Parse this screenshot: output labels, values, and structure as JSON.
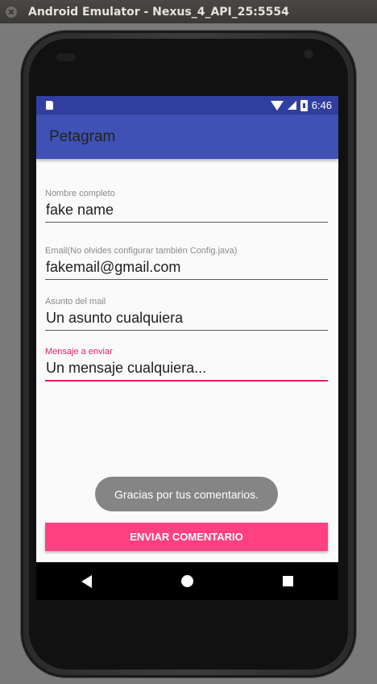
{
  "window": {
    "title": "Android Emulator - Nexus_4_API_25:5554"
  },
  "status_bar": {
    "time": "6:46",
    "icons": [
      "sd-card-icon",
      "wifi-icon",
      "signal-icon",
      "battery-icon"
    ]
  },
  "app_bar": {
    "title": "Petagram"
  },
  "form": {
    "name": {
      "label": "Nombre completo",
      "value": "fake name"
    },
    "email": {
      "label": "Email(No olvides configurar también Config.java)",
      "value": "fakemail@gmail.com"
    },
    "subject": {
      "label": "Asunto del mail",
      "value": "Un asunto cualquiera"
    },
    "message": {
      "label": "Mensaje a enviar",
      "value": "Un mensaje cualquiera..."
    }
  },
  "toast": {
    "text": "Gracias por tus comentarios."
  },
  "send_button": {
    "label": "ENVIAR COMENTARIO"
  },
  "colors": {
    "primary": "#3f51b5",
    "primary_dark": "#303f9f",
    "accent": "#ff4081",
    "focus": "#e91e63"
  },
  "nav_bar": {
    "icons": [
      "back-icon",
      "home-icon",
      "recents-icon"
    ]
  }
}
